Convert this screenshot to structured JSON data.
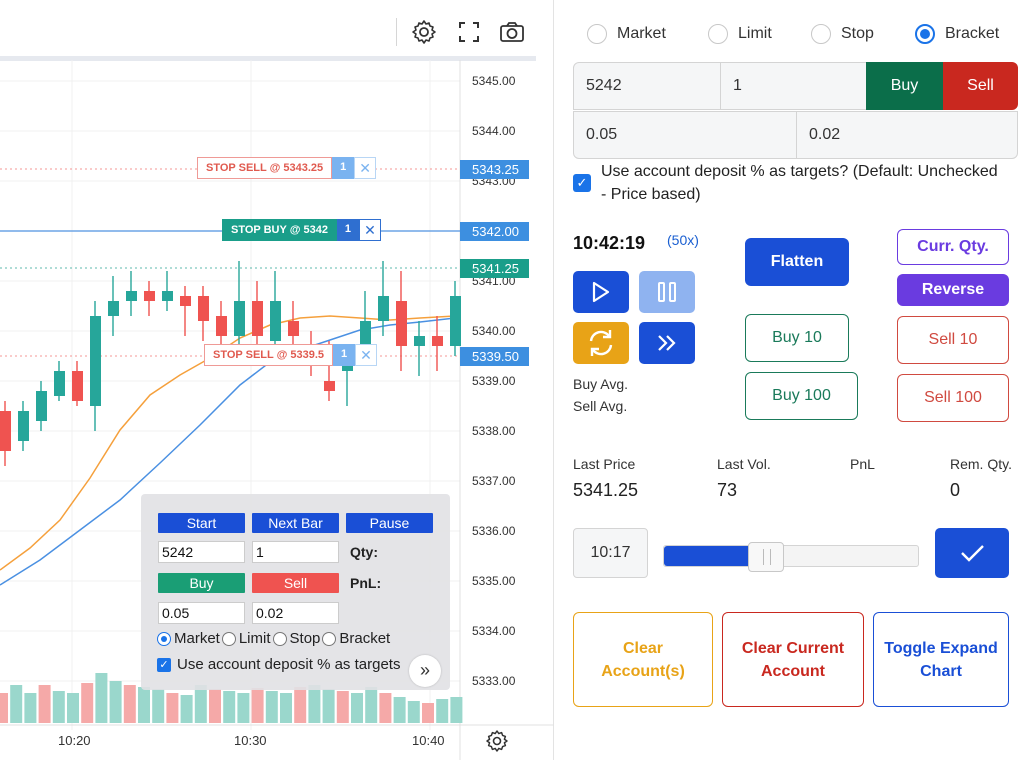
{
  "chart": {
    "price_axis": [
      "5345.00",
      "5344.00",
      "5343.00",
      "5342.00",
      "5341.00",
      "5340.00",
      "5339.00",
      "5338.00",
      "5337.00",
      "5336.00",
      "5335.00",
      "5334.00",
      "5333.00"
    ],
    "time_axis": [
      "10:20",
      "10:30",
      "10:40"
    ],
    "orders": [
      {
        "label": "STOP SELL @ 5343.25",
        "qty": "1",
        "price_tag": "5343.25",
        "kind": "sell"
      },
      {
        "label": "STOP BUY @ 5342",
        "qty": "1",
        "price_tag": "5342.00",
        "kind": "buy"
      },
      {
        "label": "STOP SELL @ 5339.5",
        "qty": "1",
        "price_tag": "5339.50",
        "kind": "sell"
      }
    ],
    "last_price_tag": "5341.25",
    "colors": {
      "up": "#26a69a",
      "down": "#ef5350",
      "sma_fast": "#f5a03c",
      "sma_slow": "#4a90e2",
      "stop_buy": "#1a9e8a",
      "stop_sell": "#ef5350",
      "price_blue": "#3d8fe0"
    }
  },
  "float_panel": {
    "start": "Start",
    "next_bar": "Next Bar",
    "pause": "Pause",
    "price_value": "5242",
    "qty_value": "1",
    "qty_label": "Qty:",
    "buy": "Buy",
    "sell": "Sell",
    "pnl_label": "PnL:",
    "tp_value": "0.05",
    "sl_value": "0.02",
    "order_types": [
      "Market",
      "Limit",
      "Stop",
      "Bracket"
    ],
    "selected_order_type": "Market",
    "deposit_check": "Use account deposit % as targets"
  },
  "trade_panel": {
    "order_types": [
      "Market",
      "Limit",
      "Stop",
      "Bracket"
    ],
    "selected_order_type": "Bracket",
    "price_value": "5242",
    "qty_value": "1",
    "buy": "Buy",
    "sell": "Sell",
    "tp_value": "0.05",
    "sl_value": "0.02",
    "deposit_check": "Use account deposit % as targets? (Default: Unchecked - Price based)",
    "clock": "10:42:19",
    "speed": "(50x)",
    "flatten": "Flatten",
    "curr_qty": "Curr. Qty.",
    "reverse": "Reverse",
    "buy10": "Buy 10",
    "sell10": "Sell 10",
    "buy100": "Buy 100",
    "sell100": "Sell 100",
    "buy_avg": "Buy Avg.",
    "sell_avg": "Sell Avg.",
    "stats": [
      {
        "label": "Last Price",
        "value": "5341.25"
      },
      {
        "label": "Last Vol.",
        "value": "73"
      },
      {
        "label": "PnL",
        "value": ""
      },
      {
        "label": "Rem. Qty.",
        "value": "0"
      }
    ],
    "slider_time": "10:17",
    "slider_progress": 0.4,
    "clear_accounts": "Clear Account(s)",
    "clear_current": "Clear Current Account",
    "toggle_expand": "Toggle Expand Chart"
  }
}
